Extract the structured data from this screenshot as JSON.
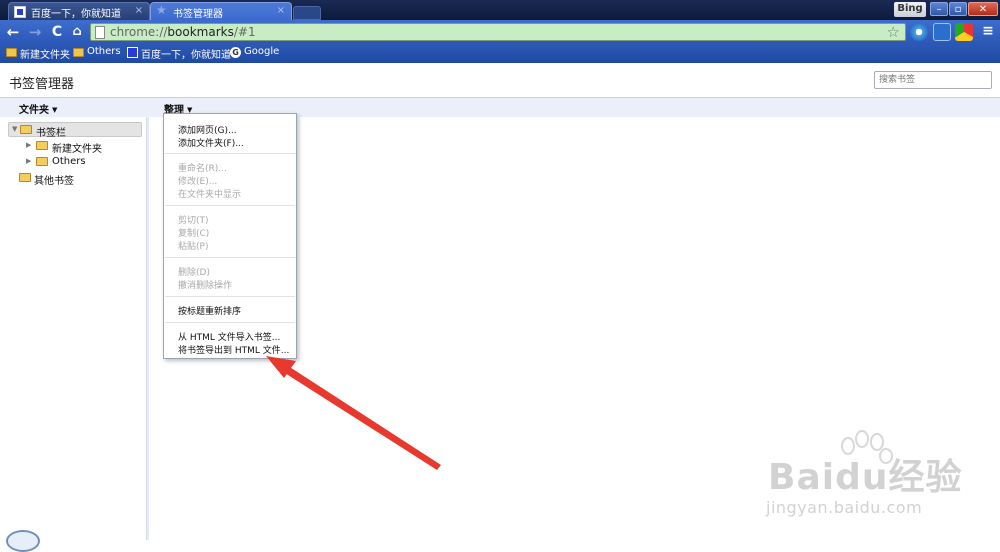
{
  "browser": {
    "tabs": [
      {
        "title": "百度一下，你就知道",
        "close": "×"
      },
      {
        "title": "书签管理器",
        "close": "×"
      }
    ],
    "bing_label": "Bing",
    "window_controls": {
      "minimize": "–",
      "maximize": "▫",
      "close": "✕"
    },
    "nav": {
      "back": "←",
      "forward": "→",
      "reload": "C",
      "home": "⌂"
    },
    "url": {
      "scheme": "chrome://",
      "host": "bookmarks",
      "path": "/#1"
    },
    "menu_icon": "≡",
    "bookmarks_bar": [
      {
        "label": "新建文件夹",
        "icon": "folder-icon"
      },
      {
        "label": "Others",
        "icon": "folder-icon"
      },
      {
        "label": "百度一下，你就知道",
        "icon": "baidu-favicon"
      },
      {
        "label": "Google",
        "icon": "google-favicon"
      }
    ]
  },
  "manager": {
    "title": "书签管理器",
    "search_placeholder": "搜索书签",
    "folders_menu": "文件夹",
    "organize_menu": "整理",
    "tree": [
      {
        "label": "书签栏",
        "expanded": true
      },
      {
        "label": "新建文件夹"
      },
      {
        "label": "Others"
      },
      {
        "label": "其他书签"
      }
    ]
  },
  "organize_popup": {
    "groups": [
      [
        {
          "label": "添加网页(G)...",
          "enabled": true
        },
        {
          "label": "添加文件夹(F)...",
          "enabled": true
        }
      ],
      [
        {
          "label": "重命名(R)...",
          "enabled": false
        },
        {
          "label": "修改(E)...",
          "enabled": false
        },
        {
          "label": "在文件夹中显示",
          "enabled": false
        }
      ],
      [
        {
          "label": "剪切(T)",
          "enabled": false
        },
        {
          "label": "复制(C)",
          "enabled": false
        },
        {
          "label": "粘贴(P)",
          "enabled": false
        }
      ],
      [
        {
          "label": "删除(D)",
          "enabled": false
        },
        {
          "label": "撤消删除操作",
          "enabled": false
        }
      ],
      [
        {
          "label": "按标题重新排序",
          "enabled": true
        }
      ],
      [
        {
          "label": "从 HTML 文件导入书签...",
          "enabled": true
        },
        {
          "label": "将书签导出到 HTML 文件...",
          "enabled": true
        }
      ]
    ]
  },
  "watermark": {
    "logo": "Baidu经验",
    "url": "jingyan.baidu.com"
  },
  "colors": {
    "annotation_arrow": "#e8392f",
    "omnibox_bg": "#c8ecc4",
    "toolbar": "#3f6dcd"
  }
}
